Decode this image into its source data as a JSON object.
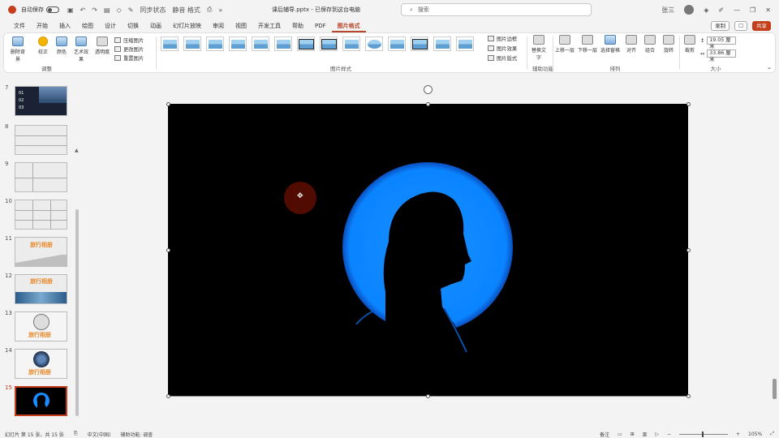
{
  "titlebar": {
    "autosave_label": "自动保存",
    "toggle_state": "关",
    "qat_label_1": "同步状态",
    "qat_label_2": "静音 格式",
    "doc_title": "课后辅导.pptx - 已保存到这台电脑",
    "search_placeholder": "搜索",
    "user_name": "张三"
  },
  "tabs": [
    "文件",
    "开始",
    "插入",
    "绘图",
    "设计",
    "切换",
    "动画",
    "幻灯片放映",
    "审阅",
    "视图",
    "开发工具",
    "帮助",
    "PDF",
    "图片格式"
  ],
  "tabs_right": {
    "record": "录制",
    "share": "共享"
  },
  "ribbon": {
    "adjust": {
      "remove_bg": "删除背景",
      "corrections": "校正",
      "color": "颜色",
      "artistic": "艺术效果",
      "transparency": "透明度",
      "compress": "压缩图片",
      "change": "更改图片",
      "reset": "重置图片",
      "label": "调整"
    },
    "styles": {
      "label": "图片样式",
      "border": "图片边框",
      "effects": "图片效果",
      "layout": "图片版式"
    },
    "accessibility": {
      "alt_text": "替换文字",
      "label": "辅助功能"
    },
    "arrange": {
      "forward": "上移一层",
      "backward": "下移一层",
      "selection_pane": "选择窗格",
      "align": "对齐",
      "group": "组合",
      "rotate": "旋转",
      "label": "排列"
    },
    "size": {
      "crop": "裁剪",
      "height": "19.05 厘米",
      "width": "33.86 厘米",
      "label": "大小"
    }
  },
  "thumbnails": [
    {
      "num": "7",
      "type": "dark-list",
      "lines": [
        "01",
        "02",
        "03"
      ]
    },
    {
      "num": "8",
      "type": "grid-2"
    },
    {
      "num": "9",
      "type": "grid-3"
    },
    {
      "num": "10",
      "type": "grid-4"
    },
    {
      "num": "11",
      "type": "title-orange",
      "title": "旅行相册"
    },
    {
      "num": "12",
      "type": "title-orange-photo",
      "title": "旅行相册"
    },
    {
      "num": "13",
      "type": "title-circle",
      "title": "旅行相册"
    },
    {
      "num": "14",
      "type": "title-photo-circle",
      "title": "旅行相册"
    },
    {
      "num": "15",
      "type": "current"
    }
  ],
  "statusbar": {
    "slide_info": "幻灯片 第 15 张，共 15 张",
    "language": "中文(中国)",
    "accessibility": "辅助功能: 调查",
    "notes": "备注",
    "zoom": "105%"
  }
}
